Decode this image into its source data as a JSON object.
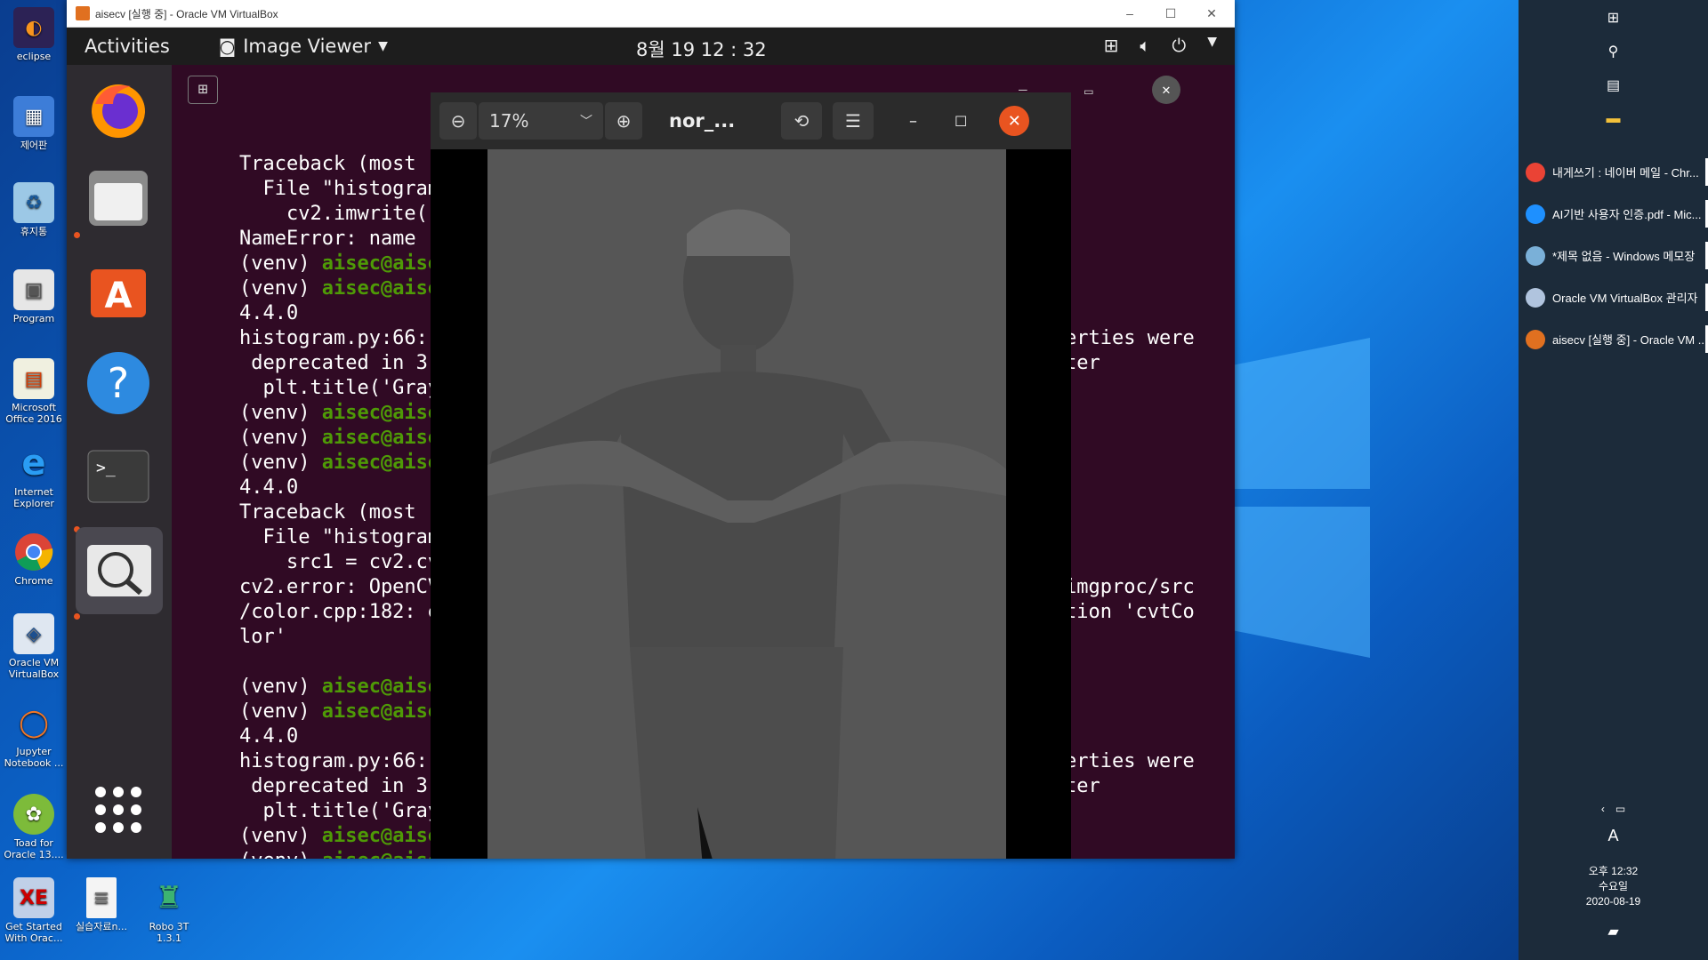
{
  "desktop": {
    "icons": [
      {
        "label": "eclipse"
      },
      {
        "label": "제어판"
      },
      {
        "label": "휴지통"
      },
      {
        "label": "Program"
      },
      {
        "label": "Microsoft Office 2016"
      },
      {
        "label": "Internet Explorer"
      },
      {
        "label": "Chrome"
      },
      {
        "label": "Oracle VM VirtualBox"
      },
      {
        "label": "Jupyter Notebook ..."
      },
      {
        "label": "Toad for Oracle 13...."
      },
      {
        "label": "Get Started With Orac..."
      },
      {
        "label": "실습자료n..."
      },
      {
        "label": "Robo 3T 1.3.1"
      }
    ]
  },
  "vbox": {
    "title": "aisecv [실행 중] - Oracle VM VirtualBox",
    "controls": [
      "–",
      "☐",
      "✕"
    ]
  },
  "ubuntu": {
    "activities": "Activities",
    "app_name": "Image Viewer",
    "clock": "8월 19  12 : 32"
  },
  "terminal": {
    "lines": [
      {
        "pre": "Traceback (most rece",
        "green": ""
      },
      {
        "pre": "  File \"histogram.py",
        "green": ""
      },
      {
        "pre": "    cv2.imwrite('1_r",
        "green": ""
      },
      {
        "pre": "NameError: name 'hsv",
        "green": ""
      },
      {
        "pre": "(venv) ",
        "green": "aisec@aisec-V"
      },
      {
        "pre": "(venv) ",
        "green": "aisec@aisec-V"
      },
      {
        "pre": "4.4.0",
        "green": ""
      },
      {
        "pre": "histogram.py:66: Mat",
        "green": ""
      },
      {
        "pre": " deprecated in 3.3 a",
        "green": ""
      },
      {
        "pre": "  plt.title('Graysca",
        "green": ""
      },
      {
        "pre": "(venv) ",
        "green": "aisec@aisec-V"
      },
      {
        "pre": "(venv) ",
        "green": "aisec@aisec-V"
      },
      {
        "pre": "(venv) ",
        "green": "aisec@aisec-V"
      },
      {
        "pre": "4.4.0",
        "green": ""
      },
      {
        "pre": "Traceback (most rece",
        "green": ""
      },
      {
        "pre": "  File \"histogram.py",
        "green": ""
      },
      {
        "pre": "    src1 = cv2.cvtCo",
        "green": ""
      },
      {
        "pre": "cv2.error: OpenCV(4.",
        "green": ""
      },
      {
        "pre": "/color.cpp:182: erro",
        "green": ""
      },
      {
        "pre": "lor'",
        "green": ""
      },
      {
        "pre": "",
        "green": ""
      },
      {
        "pre": "(venv) ",
        "green": "aisec@aisec-V"
      },
      {
        "pre": "(venv) ",
        "green": "aisec@aisec-V"
      },
      {
        "pre": "4.4.0",
        "green": ""
      },
      {
        "pre": "histogram.py:66: Mat",
        "green": ""
      },
      {
        "pre": " deprecated in 3.3 a",
        "green": ""
      },
      {
        "pre": "  plt.title('Graysca",
        "green": ""
      },
      {
        "pre": "(venv) ",
        "green": "aisec@aisec-V"
      },
      {
        "pre": "(venv) ",
        "green": "aisec@aisec-V"
      }
    ],
    "right_fragments": [
      {
        "row": 7,
        "text": "erties were"
      },
      {
        "row": 8,
        "text": "ter"
      },
      {
        "row": 17,
        "text": "imgproc/src"
      },
      {
        "row": 18,
        "text": "tion 'cvtCo"
      },
      {
        "row": 24,
        "text": "erties were"
      },
      {
        "row": 25,
        "text": "ter"
      }
    ]
  },
  "viewer": {
    "zoom": "17%",
    "filename": "nor_..."
  },
  "taskbar": {
    "tasks": [
      {
        "label": "내게쓰기 : 네이버 메일 - Chr...",
        "color": "#ea4335"
      },
      {
        "label": "AI기반 사용자 인증.pdf - Mic...",
        "color": "#1e90ff"
      },
      {
        "label": "*제목 없음 - Windows 메모장",
        "color": "#7ab0d8"
      },
      {
        "label": "Oracle VM VirtualBox 관리자",
        "color": "#b0c4de"
      },
      {
        "label": "aisecv [실행 중] - Oracle VM ...",
        "color": "#e07020"
      }
    ],
    "ime": "A",
    "time": "오후 12:32",
    "weekday": "수요일",
    "date": "2020-08-19"
  }
}
